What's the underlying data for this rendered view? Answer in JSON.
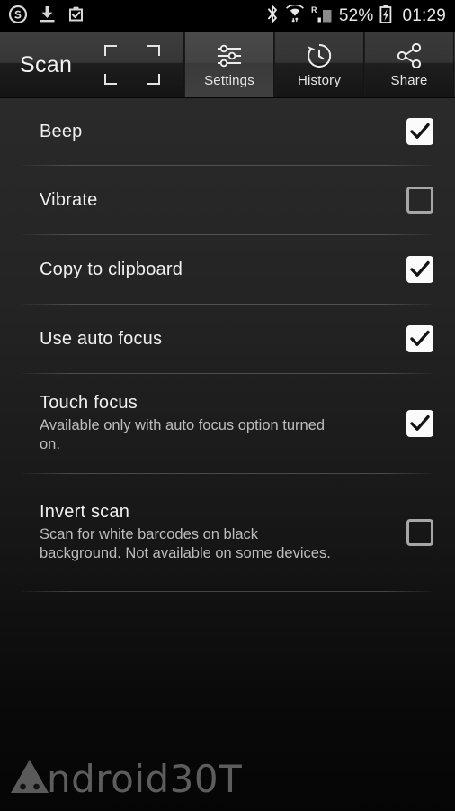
{
  "status_bar": {
    "left_icons": [
      {
        "name": "skype-icon",
        "label": "Skype"
      },
      {
        "name": "download-icon",
        "label": "Download"
      },
      {
        "name": "clipboard-check-icon",
        "label": "Task complete"
      }
    ],
    "right_icons": [
      {
        "name": "bluetooth-icon",
        "label": "Bluetooth"
      },
      {
        "name": "wifi-icon",
        "label": "Wi-Fi"
      },
      {
        "name": "roaming-signal-icon",
        "label": "R"
      },
      {
        "name": "battery-charging-icon",
        "label": "Charging"
      }
    ],
    "battery_percent": "52%",
    "roaming_label": "R",
    "clock": "01:29"
  },
  "action_bar": {
    "title": "Scan",
    "viewfinder_icon": "viewfinder-brackets-icon",
    "tabs": [
      {
        "label": "Settings",
        "icon": "sliders-icon",
        "selected": true
      },
      {
        "label": "History",
        "icon": "history-clock-icon",
        "selected": false
      },
      {
        "label": "Share",
        "icon": "share-nodes-icon",
        "selected": false
      }
    ]
  },
  "settings": {
    "items": [
      {
        "title": "Beep",
        "subtitle": "",
        "checked": true
      },
      {
        "title": "Vibrate",
        "subtitle": "",
        "checked": false
      },
      {
        "title": "Copy to clipboard",
        "subtitle": "",
        "checked": true
      },
      {
        "title": "Use auto focus",
        "subtitle": "",
        "checked": true
      },
      {
        "title": "Touch focus",
        "subtitle": "Available only with auto focus option turned on.",
        "checked": true
      },
      {
        "title": "Invert scan",
        "subtitle": "Scan for white barcodes on black background. Not available on some devices.",
        "checked": false
      }
    ]
  },
  "watermark": {
    "text": "ndroid30T",
    "full_text": "Android30T",
    "icon": "android-head-icon"
  },
  "colors": {
    "background": "#0a0a0a",
    "action_bar": "#2b2b2b",
    "selected_tab": "#434343",
    "text_primary": "#f0f0f0",
    "text_secondary": "#bdbdbd",
    "checkbox_on": "#fbfbfb",
    "checkbox_off_border": "#a6a6a6",
    "watermark": "#5d5d5d"
  }
}
